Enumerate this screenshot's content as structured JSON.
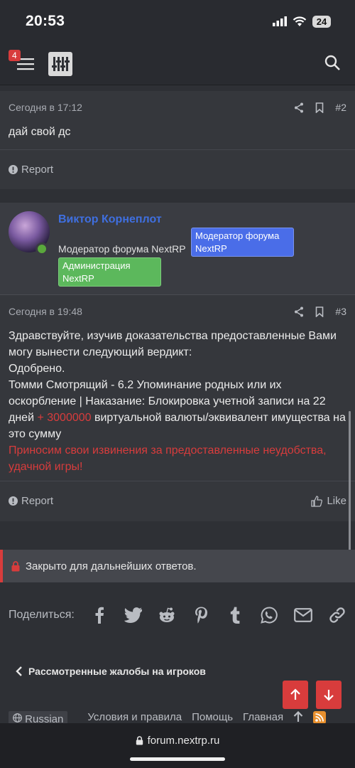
{
  "status_bar": {
    "time": "20:53",
    "battery": "24"
  },
  "nav": {
    "notification_count": "4"
  },
  "post2": {
    "date": "Сегодня в 17:12",
    "number": "#2",
    "text": "дай свой дс",
    "report": "Report"
  },
  "author": {
    "name": "Виктор Корнеплот",
    "title": "Модератор форума NextRP",
    "badge_moderator": "Модератор форума NextRP",
    "badge_admin": "Администрация NextRP"
  },
  "post3": {
    "date": "Сегодня в 19:48",
    "number": "#3",
    "line1": "Здравствуйте, изучив доказательства предоставленные Вами могу вынести следующий вердикт:",
    "line2": "Одобрено.",
    "line3_pre": "Томми Смотрящий - 6.2 Упоминание родных или их оскорбление | Наказание: Блокировка учетной записи на 22 дней ",
    "line3_red": "+ 3000000",
    "line3_post": " виртуальной валюты/эквивалент имущества на это сумму",
    "apology": "Приносим свои извинения за предоставленные неудобства, удачной игры!",
    "report": "Report",
    "like": "Like"
  },
  "closed_notice": "Закрыто для дальнейших ответов.",
  "share": {
    "label": "Поделиться:",
    "icons": [
      "facebook-icon",
      "twitter-icon",
      "reddit-icon",
      "pinterest-icon",
      "tumblr-icon",
      "whatsapp-icon",
      "email-icon",
      "link-icon"
    ]
  },
  "breadcrumb": "Рассмотренные жалобы на игроков",
  "footer": {
    "language": "Russian",
    "links": [
      "Условия и правила",
      "Помощь",
      "Главная"
    ]
  },
  "url": "forum.nextrp.ru",
  "colors": {
    "accent_red": "#d83c3c",
    "author_blue": "#3f6fe0",
    "mod_badge": "#4a6de8",
    "admin_badge": "#5cb85c"
  }
}
